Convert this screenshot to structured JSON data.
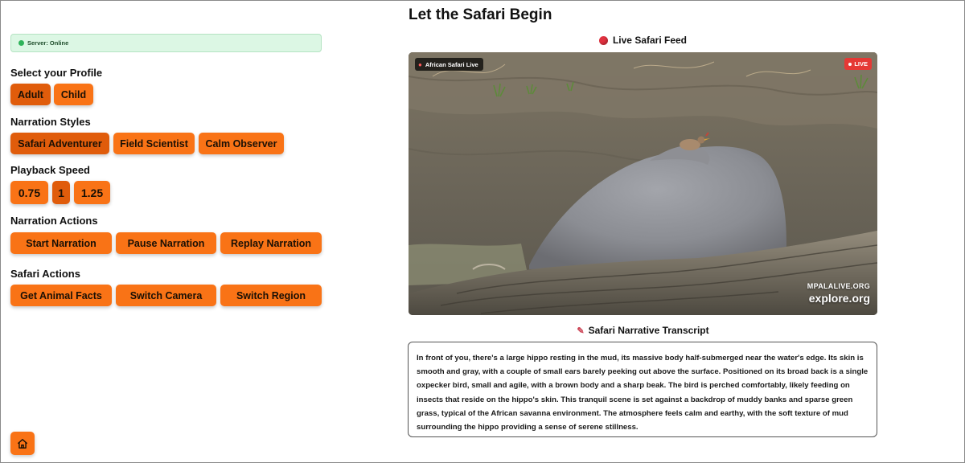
{
  "server": {
    "status": "Server: Online"
  },
  "profile": {
    "title": "Select your Profile",
    "options": [
      "Adult",
      "Child"
    ],
    "selected": "Adult"
  },
  "narration_styles": {
    "title": "Narration Styles",
    "options": [
      "Safari Adventurer",
      "Field Scientist",
      "Calm Observer"
    ],
    "selected": "Safari Adventurer"
  },
  "playback_speed": {
    "title": "Playback Speed",
    "options": [
      "0.75",
      "1",
      "1.25"
    ],
    "selected": "1"
  },
  "narration_actions": {
    "title": "Narration Actions",
    "buttons": [
      "Start Narration",
      "Pause Narration",
      "Replay Narration"
    ]
  },
  "safari_actions": {
    "title": "Safari Actions",
    "buttons": [
      "Get Animal Facts",
      "Switch Camera",
      "Switch Region"
    ]
  },
  "page": {
    "title": "Let the Safari Begin"
  },
  "feed": {
    "label": "Live Safari Feed",
    "camera_name": "African Safari Live",
    "live_badge": "LIVE",
    "watermark_top": "MPALALIVE.ORG",
    "watermark_bottom": "explore.org"
  },
  "transcript": {
    "label": "Safari Narrative Transcript",
    "text": "In front of you, there's a large hippo resting in the mud, its massive body half-submerged near the water's edge. Its skin is smooth and gray, with a couple of small ears barely peeking out above the surface. Positioned on its broad back is a single oxpecker bird, small and agile, with a brown body and a sharp beak. The bird is perched comfortably, likely feeding on insects that reside on the hippo's skin. This tranquil scene is set against a backdrop of muddy banks and sparse green grass, typical of the African savanna environment. The atmosphere feels calm and earthy, with the soft texture of mud surrounding the hippo providing a sense of serene stillness."
  },
  "colors": {
    "button": "#f97316",
    "button_active": "#e05c0b",
    "server_bg": "#dcf7e4",
    "live": "#e53935"
  },
  "icons": {
    "home": "home-icon",
    "status": "status-dot-icon",
    "feed": "red-circle-icon",
    "camera_location": "location-pin-icon",
    "transcript": "memo-icon"
  }
}
